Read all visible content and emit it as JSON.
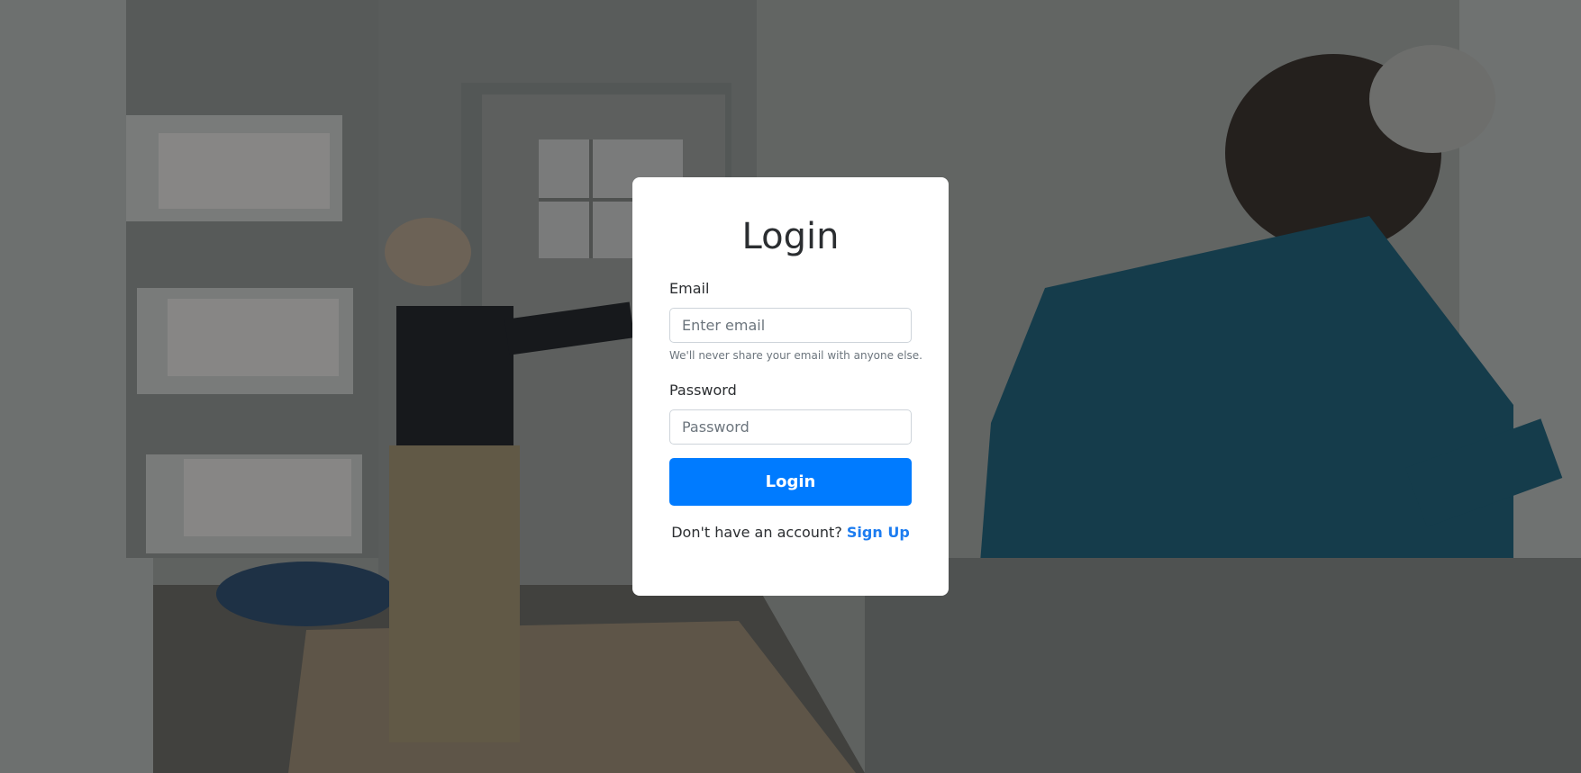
{
  "form": {
    "title": "Login",
    "email_label": "Email",
    "email_placeholder": "Enter email",
    "email_help": "We'll never share your email with anyone else.",
    "password_label": "Password",
    "password_placeholder": "Password",
    "submit_label": "Login",
    "signup_prompt": "Don't have an account? ",
    "signup_link": "Sign Up"
  },
  "colors": {
    "primary": "#007bff",
    "link": "#1c7cf0",
    "text": "#2b2e31",
    "muted": "#6c757d"
  }
}
